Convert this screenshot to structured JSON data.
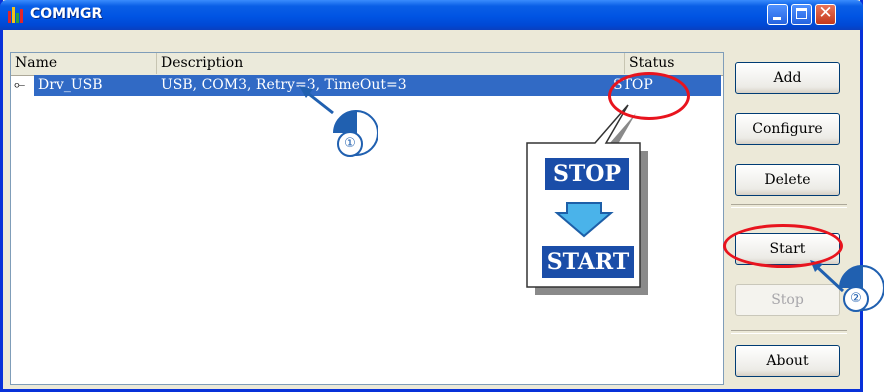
{
  "window": {
    "title": "COMMGR"
  },
  "list": {
    "columns": {
      "name": "Name",
      "description": "Description",
      "status": "Status"
    },
    "rows": [
      {
        "name": "Drv_USB",
        "description": "USB, COM3, Retry=3, TimeOut=3",
        "status": "STOP",
        "icon": "usb-icon"
      }
    ]
  },
  "buttons": {
    "add": "Add",
    "configure": "Configure",
    "delete": "Delete",
    "start": "Start",
    "stop": "Stop",
    "about": "About"
  },
  "callout": {
    "from": "STOP",
    "to": "START",
    "arrow": "down-arrow-icon"
  },
  "annotations": {
    "step1": "①",
    "step2": "②",
    "highlight_color": "#e8141e",
    "marker_color": "#2060b0"
  }
}
